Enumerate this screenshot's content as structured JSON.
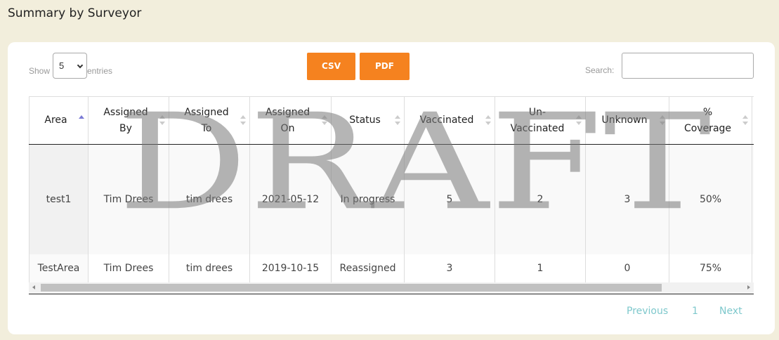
{
  "page": {
    "title": "Summary by Surveyor"
  },
  "controls": {
    "length_prefix": "Show",
    "length_value": "5",
    "length_suffix": "entries",
    "csv_label": "CSV",
    "pdf_label": "PDF",
    "search_label": "Search:",
    "search_value": ""
  },
  "table": {
    "headers": [
      "Area",
      "Assigned By",
      "Assigned To",
      "Assigned On",
      "Status",
      "Vaccinated",
      "Un-Vaccinated",
      "Unknown",
      "% Coverage"
    ],
    "header_lines": [
      [
        "Area"
      ],
      [
        "Assigned",
        "By"
      ],
      [
        "Assigned",
        "To"
      ],
      [
        "Assigned",
        "On"
      ],
      [
        "Status"
      ],
      [
        "Vaccinated"
      ],
      [
        "Un-",
        "Vaccinated"
      ],
      [
        "Unknown"
      ],
      [
        "%",
        "Coverage"
      ]
    ],
    "sorted_column": "Area",
    "sort_direction": "ascending",
    "rows": [
      [
        "test1",
        "Tim Drees",
        "tim drees",
        "2021-05-12",
        "In progress",
        "5",
        "2",
        "3",
        "50%"
      ],
      [
        "TestArea",
        "Tim Drees",
        "tim drees",
        "2019-10-15",
        "Reassigned",
        "3",
        "1",
        "0",
        "75%"
      ]
    ]
  },
  "pagination": {
    "previous": "Previous",
    "current": "1",
    "next": "Next"
  },
  "watermark": "DRAFT",
  "colors": {
    "button": "#f5821f",
    "pager_link": "#7ec8cc",
    "background": "#f2eedc"
  }
}
